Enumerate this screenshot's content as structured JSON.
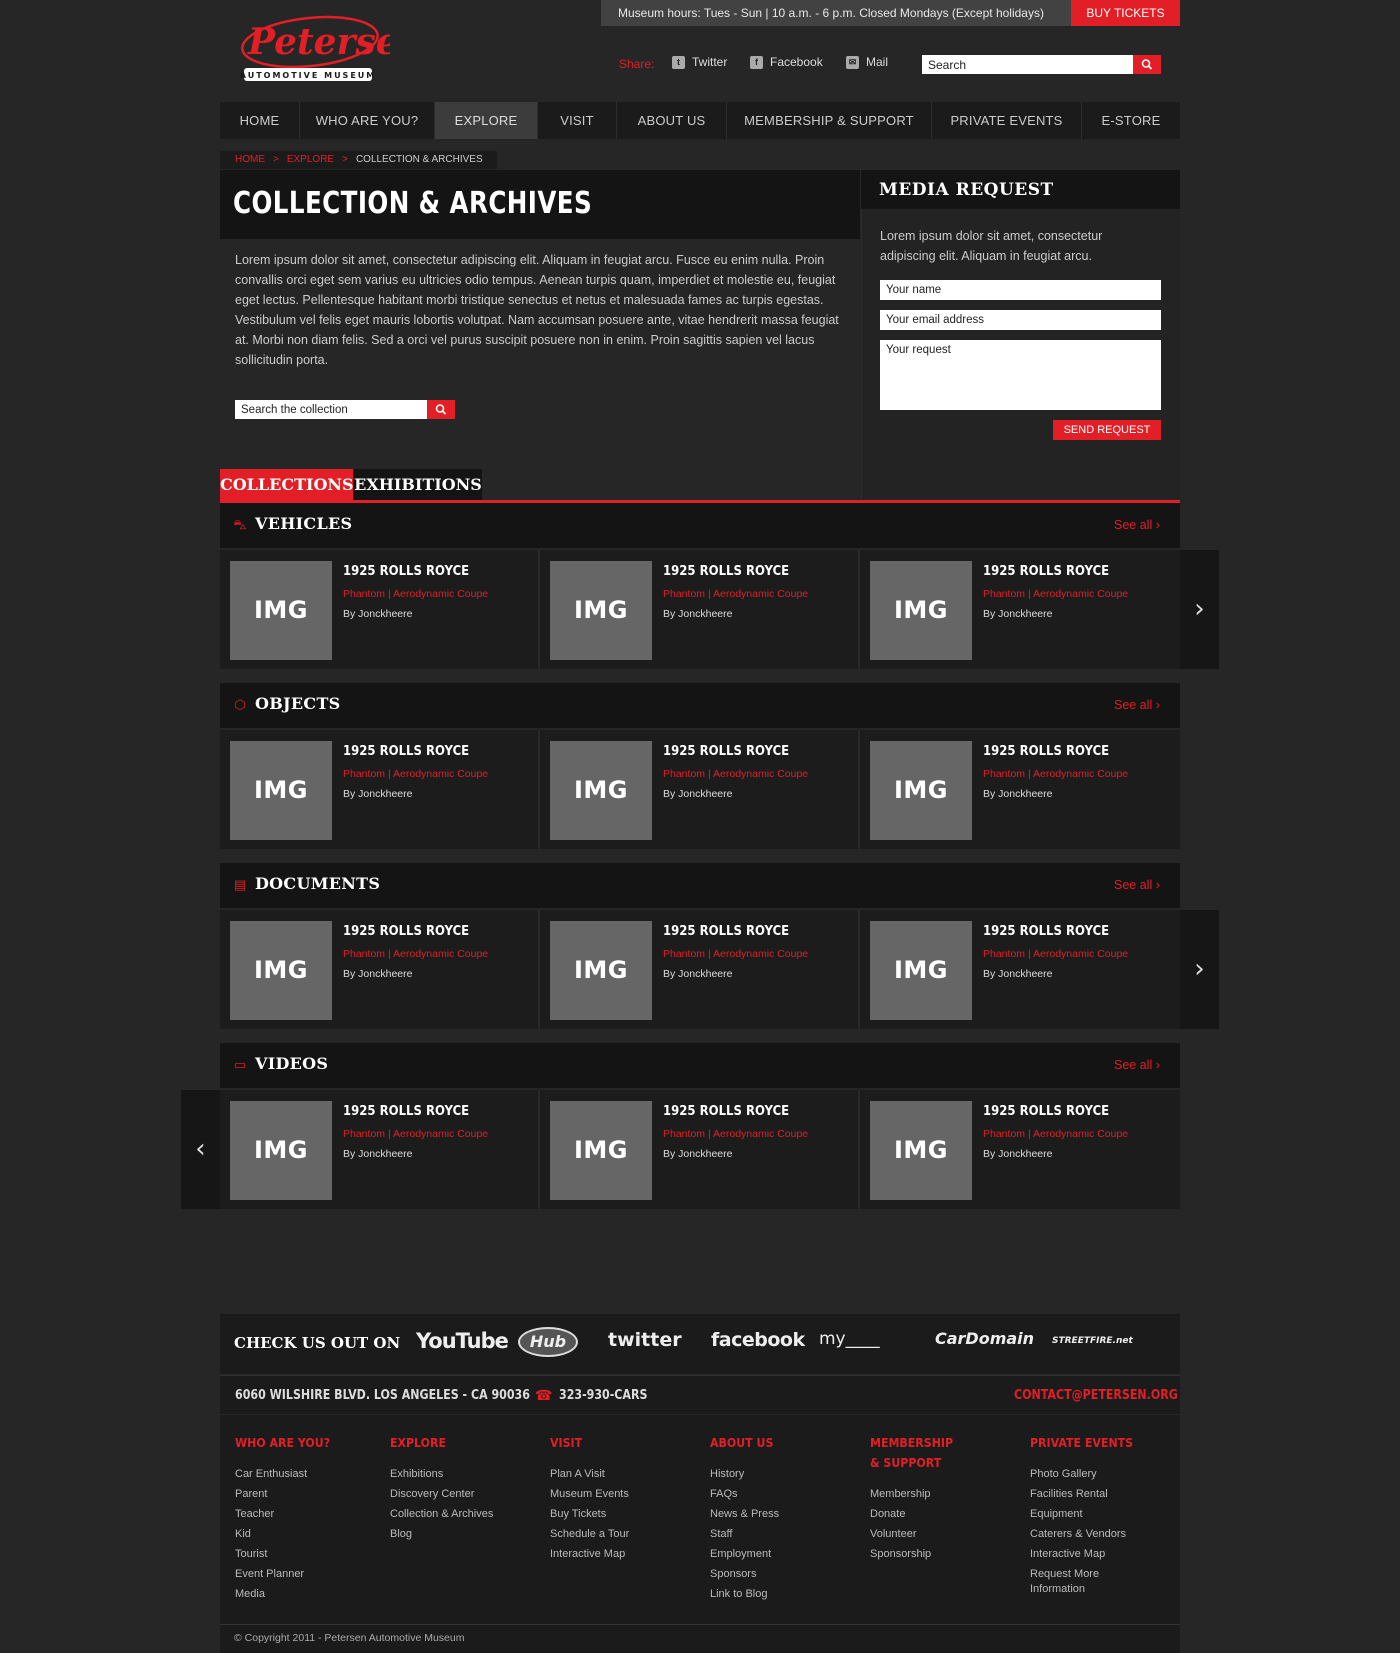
{
  "topbar": {
    "hours": "Museum hours: Tues - Sun | 10 a.m. - 6 p.m. Closed Mondays (Except holidays)",
    "buy_tickets": "BUY TICKETS"
  },
  "logo": {
    "name": "Petersen",
    "tagline": "AUTOMOTIVE MUSEUM"
  },
  "share": {
    "label": "Share:",
    "items": [
      "Twitter",
      "Facebook",
      "Mail"
    ]
  },
  "search": {
    "value": "Search"
  },
  "nav": [
    "HOME",
    "WHO ARE YOU?",
    "EXPLORE",
    "VISIT",
    "ABOUT US",
    "MEMBERSHIP & SUPPORT",
    "PRIVATE EVENTS",
    "E-STORE"
  ],
  "nav_active": "EXPLORE",
  "breadcrumb": {
    "items": [
      "HOME",
      "EXPLORE"
    ],
    "current": "COLLECTION & ARCHIVES",
    "separator": ">"
  },
  "main": {
    "title": "COLLECTION & ARCHIVES",
    "intro": "Lorem ipsum dolor sit amet, consectetur adipiscing elit. Aliquam in feugiat arcu. Fusce eu enim nulla. Proin convallis orci eget sem varius eu ultricies odio tempus. Aenean turpis quam, imperdiet et molestie eu, feugiat eget lectus. Pellentesque habitant morbi tristique senectus et netus et malesuada fames ac turpis egestas. Vestibulum vel felis eget mauris lobortis volutpat. Nam accumsan posuere ante, vitae hendrerit massa feugiat at. Morbi non diam felis. Sed a orci vel purus suscipit posuere non in enim. Proin sagittis sapien vel lacus sollicitudin porta.",
    "search_value": "Search the collection"
  },
  "media_request": {
    "title": "MEDIA REQUEST",
    "text": "Lorem ipsum dolor sit amet, consectetur adipiscing elit. Aliquam in feugiat arcu.",
    "name_value": "Your name",
    "email_value": "Your email address",
    "request_value": "Your request",
    "send": "SEND REQUEST"
  },
  "tabs": {
    "collections": "COLLECTIONS",
    "exhibitions": "EXHIBITIONS"
  },
  "sections": [
    {
      "title": "VEHICLES",
      "icon": "car-icon",
      "see_all": "See all  ›"
    },
    {
      "title": "OBJECTS",
      "icon": "cube-icon",
      "see_all": "See all  ›"
    },
    {
      "title": "DOCUMENTS",
      "icon": "document-icon",
      "see_all": "See all  ›"
    },
    {
      "title": "VIDEOS",
      "icon": "tv-icon",
      "see_all": "See all  ›"
    }
  ],
  "card": {
    "img": "IMG",
    "title": "1925 ROLLS ROYCE",
    "subtitle": "Phantom | Aerodynamic Coupe",
    "by": "By Jonckheere"
  },
  "social": {
    "title": "CHECK US OUT ON",
    "links": [
      "YouTube",
      "Hub",
      "twitter",
      "facebook",
      "my____",
      "CarDomain",
      "STREETFIRE.net"
    ]
  },
  "contact": {
    "address": "6060 WILSHIRE BLVD. LOS ANGELES - CA 90036",
    "phone": "323-930-CARS",
    "email": "CONTACT@PETERSEN.ORG"
  },
  "footer": {
    "columns": [
      {
        "heading": "WHO ARE YOU?",
        "links": [
          "Car Enthusiast",
          "Parent",
          "Teacher",
          "Kid",
          "Tourist",
          "Event Planner",
          "Media"
        ]
      },
      {
        "heading": "EXPLORE",
        "links": [
          "Exhibitions",
          "Discovery Center",
          "Collection & Archives",
          "Blog"
        ]
      },
      {
        "heading": "VISIT",
        "links": [
          "Plan A Visit",
          "Museum Events",
          "Buy Tickets",
          "Schedule a Tour",
          "Interactive Map"
        ]
      },
      {
        "heading": "ABOUT US",
        "links": [
          "History",
          "FAQs",
          "News & Press",
          "Staff",
          "Employment",
          "Sponsors",
          "Link to Blog"
        ]
      },
      {
        "heading": "MEMBERSHIP\n& SUPPORT",
        "links": [
          "Membership",
          "Donate",
          "Volunteer",
          "Sponsorship"
        ]
      },
      {
        "heading": "PRIVATE EVENTS",
        "links": [
          "Photo Gallery",
          "Facilities Rental",
          "Equipment",
          "Caterers & Vendors",
          "Interactive Map",
          "Request More Information"
        ]
      }
    ],
    "copyright": "© Copyright 2011 - Petersen Automotive Museum"
  },
  "colors": {
    "accent": "#e21f26",
    "background": "#262626",
    "panel": "#141414"
  }
}
